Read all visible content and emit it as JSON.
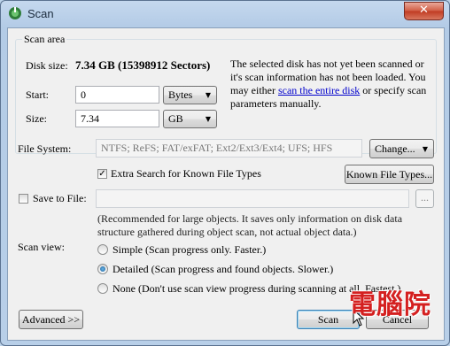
{
  "window": {
    "title": "Scan",
    "close_glyph": "✕"
  },
  "scan_area": {
    "legend": "Scan area",
    "disk_size_label": "Disk size:",
    "disk_size_value": "7.34 GB (15398912 Sectors)",
    "start_label": "Start:",
    "start_value": "0",
    "start_unit": "Bytes",
    "size_label": "Size:",
    "size_value": "7.34",
    "size_unit": "GB",
    "info_pre": "The selected disk has not yet been scanned or it's scan information has not been loaded. You may either ",
    "info_link": "scan the entire disk",
    "info_post": " or specify scan parameters manually."
  },
  "file_system": {
    "label": "File System:",
    "value": "NTFS; ReFS; FAT/exFAT; Ext2/Ext3/Ext4; UFS; HFS",
    "change_button": "Change...",
    "extra_search_label": "Extra Search for Known File Types",
    "extra_search_checked": true,
    "known_types_button": "Known File Types..."
  },
  "save": {
    "label": "Save to File:",
    "checked": false,
    "value": "",
    "browse_button": "...",
    "note": "(Recommended for large objects. It saves only information on disk data structure gathered during object scan, not actual object data.)"
  },
  "scan_view": {
    "label": "Scan view:",
    "options": [
      {
        "label": "Simple (Scan progress only. Faster.)",
        "selected": false
      },
      {
        "label": "Detailed (Scan progress and found objects. Slower.)",
        "selected": true
      },
      {
        "label": "None (Don't use scan view progress during scanning at all. Fastest.)",
        "selected": false
      }
    ]
  },
  "buttons": {
    "advanced": "Advanced >>",
    "scan": "Scan",
    "cancel": "Cancel"
  },
  "watermark": "電腦院",
  "colors": {
    "link": "#0000cc",
    "watermark": "#d42020",
    "title_bg": "#bcd3ea"
  }
}
